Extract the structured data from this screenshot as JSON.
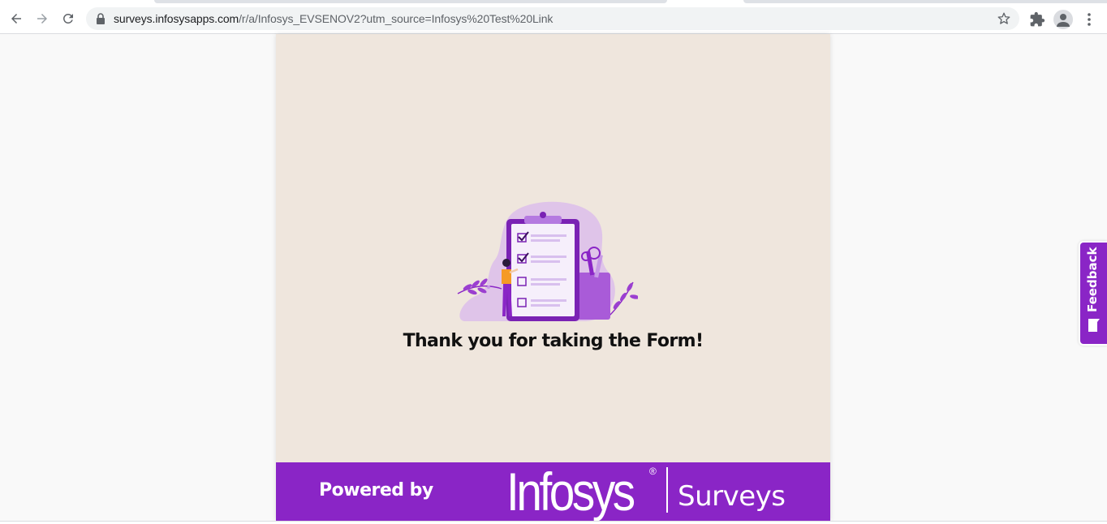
{
  "browser": {
    "url_host": "surveys.infosysapps.com",
    "url_path": "/r/a/Infosys_EVSENOV2?utm_source=Infosys%20Test%20Link",
    "icons": {
      "back": "arrow-left-icon",
      "forward": "arrow-right-icon",
      "reload": "reload-icon",
      "lock": "lock-icon",
      "bookmark": "star-icon",
      "extensions": "puzzle-icon",
      "profile": "person-icon",
      "menu": "kebab-menu-icon"
    }
  },
  "survey": {
    "thank_you_message": "Thank you for taking the Form!",
    "illustration": "clipboard-checklist-illustration"
  },
  "footer": {
    "powered_by": "Powered by",
    "brand": "Infosys",
    "registered_mark": "®",
    "product": "Surveys"
  },
  "feedback_tab": {
    "label": "Feedback",
    "icon": "speech-bubble-icon"
  },
  "colors": {
    "accent": "#8a25c6",
    "card_background": "#efe6dd",
    "page_background": "#f9f9f9"
  }
}
